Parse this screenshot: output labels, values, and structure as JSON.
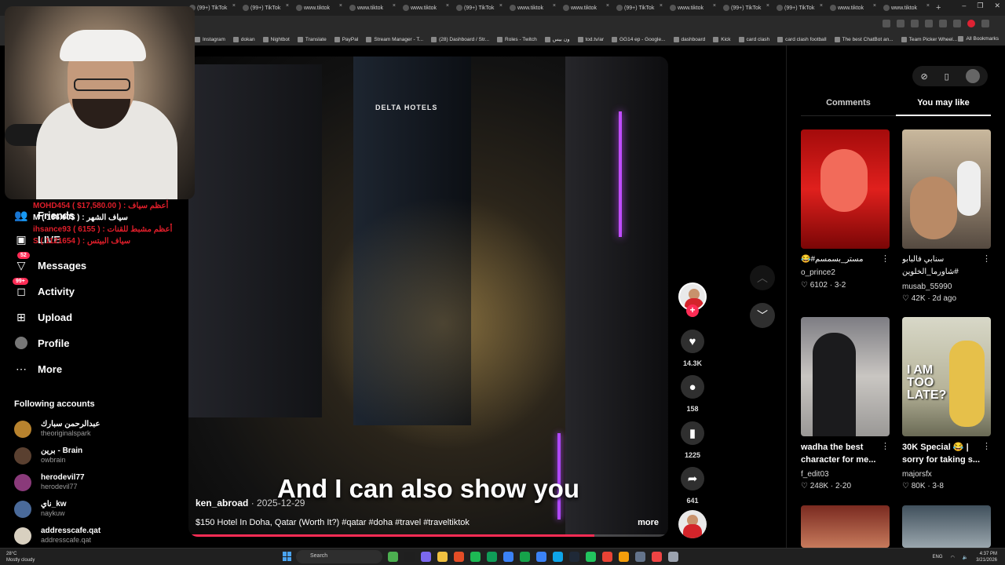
{
  "browser": {
    "tabs": [
      {
        "label": "(99+) TikTok"
      },
      {
        "label": "(99+) TikTok"
      },
      {
        "label": "www.tiktok"
      },
      {
        "label": "www.tiktok"
      },
      {
        "label": "www.tiktok"
      },
      {
        "label": "(99+) TikTok"
      },
      {
        "label": "www.tiktok"
      },
      {
        "label": "www.tiktok"
      },
      {
        "label": "(99+) TikTok"
      },
      {
        "label": "www.tiktok"
      },
      {
        "label": "(99+) TikTok"
      },
      {
        "label": "(99+) TikTok"
      },
      {
        "label": "www.tiktok"
      },
      {
        "label": "www.tiktok"
      }
    ],
    "new_tab": "+",
    "bookmarks": [
      "Instagram",
      "dokan",
      "Nightbot",
      "Translate",
      "PayPal",
      "Stream Manager - T...",
      "(28) Dashboard / Str...",
      "Roles - Twitch",
      "ون بيس",
      "tod.tv/ar",
      "GG14 ep - Google...",
      "dashboard",
      "Kick",
      "card clash",
      "card clash football",
      "The best ChatBot an...",
      "Team Picker Wheel..."
    ],
    "all_bookmarks": "All Bookmarks"
  },
  "alerts": [
    {
      "text": "MOHD454 ( $17,580.00 ) : أعظم سياف",
      "color": "red"
    },
    {
      "text": "سياف الشهر : ( $166.00 ) M",
      "color": "white"
    },
    {
      "text": "ihsance93 ( 6155 ) : أعظم مشبط للقنات",
      "color": "red"
    },
    {
      "text": "سياف البيتس : ( 1121654 ) S",
      "color": "red"
    }
  ],
  "nav": {
    "friends": "Friends",
    "live": "LIVE",
    "messages": "Messages",
    "messages_badge": "52",
    "activity": "Activity",
    "activity_badge": "99+",
    "upload": "Upload",
    "profile": "Profile",
    "more": "More"
  },
  "following": {
    "title": "Following accounts",
    "accounts": [
      {
        "name": "عبدالرحمن سبارك",
        "user": "theoriginalspark"
      },
      {
        "name": "برين - Brain",
        "user": "owbrain"
      },
      {
        "name": "herodevil77",
        "user": "herodevil77"
      },
      {
        "name": "ناي_kw",
        "user": "naykuw"
      },
      {
        "name": "addresscafe.qat",
        "user": "addresscafe.qat"
      }
    ]
  },
  "video": {
    "caption": "And I can also show you",
    "author": "ken_abroad",
    "date": "· 2025-12-29",
    "description": "$150 Hotel In Doha, Qatar (Worth It?) #qatar #doha #travel #traveltiktok",
    "more": "more",
    "progress": 0.85,
    "hotel_sign": "DELTA HOTELS"
  },
  "actions": {
    "likes": "14.3K",
    "comments": "158",
    "saves": "1225",
    "shares": "641"
  },
  "panel": {
    "tab_comments": "Comments",
    "tab_you_may_like": "You may like",
    "cards": [
      {
        "title": "😂#مستر_بسمسم",
        "user": "o_prince2",
        "stats": "♡ 6102 · 3-2"
      },
      {
        "title": "سنابي فالبابو #شاورما_الخلوين",
        "user": "musab_55990",
        "stats": "♡ 42K · 2d ago"
      },
      {
        "title": "wadha the best character for me...",
        "user": "f_edit03",
        "stats": "♡ 248K · 2-20"
      },
      {
        "title": "30K Special 😂 | sorry for taking s...",
        "user": "majorsfx",
        "stats": "♡ 80K · 3-8"
      }
    ],
    "thumb_text": "I AM TOO LATE?"
  },
  "taskbar": {
    "temp": "28°C",
    "weather": "Mostly cloudy",
    "search": "Search",
    "lang": "ENG",
    "time": "4:37 PM",
    "date": "3/21/2026"
  },
  "colors": {
    "accent": "#fe2c55",
    "neon": "#c04cff"
  }
}
